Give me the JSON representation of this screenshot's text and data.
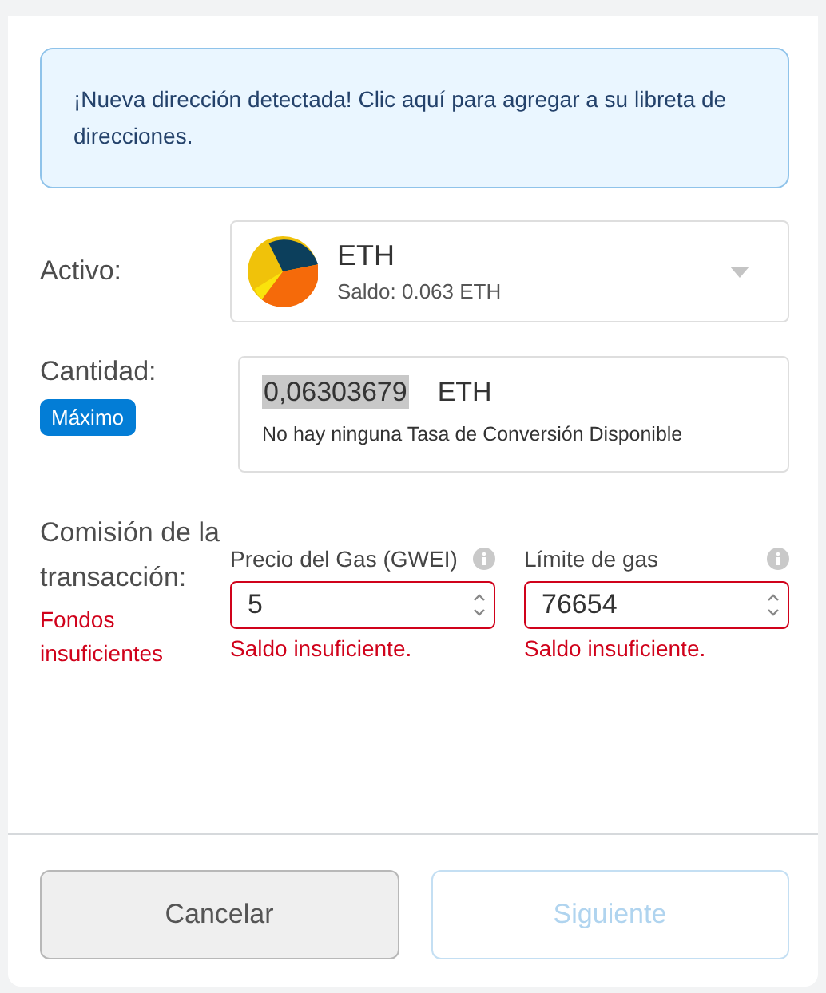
{
  "notice": {
    "text": "¡Nueva dirección detectada! Clic aquí para agregar a su libreta de direcciones."
  },
  "asset": {
    "label": "Activo:",
    "symbol": "ETH",
    "balance": "Saldo: 0.063 ETH"
  },
  "amount": {
    "label": "Cantidad:",
    "max_button": "Máximo",
    "value": "0,06303679",
    "value_selected": true,
    "unit": "ETH",
    "conversion": "No hay ninguna Tasa de Conversión Disponible"
  },
  "fee": {
    "label": "Comisión de la transacción:",
    "error": "Fondos insuficientes",
    "fields": [
      {
        "label": "Precio del Gas (GWEI)",
        "value": "5",
        "error": "Saldo insuficiente."
      },
      {
        "label": "Límite de gas",
        "value": "76654",
        "error": "Saldo insuficiente."
      }
    ]
  },
  "buttons": [
    {
      "label": "Cancelar",
      "kind": "secondary",
      "disabled": false
    },
    {
      "label": "Siguiente",
      "kind": "primary",
      "disabled": true
    }
  ]
}
